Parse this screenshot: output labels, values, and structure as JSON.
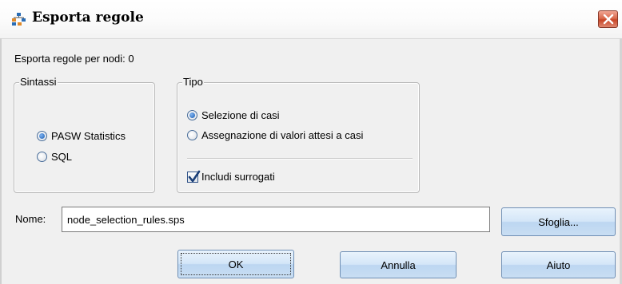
{
  "window": {
    "title": "Esporta regole",
    "icon": "tree-nodes-icon"
  },
  "nodes_label": "Esporta regole per nodi: 0",
  "syntax": {
    "legend": "Sintassi",
    "options": [
      {
        "label": "PASW Statistics",
        "checked": true
      },
      {
        "label": "SQL",
        "checked": false
      }
    ]
  },
  "type": {
    "legend": "Tipo",
    "options": [
      {
        "label": "Selezione di casi",
        "checked": true
      },
      {
        "label": "Assegnazione di valori attesi a casi",
        "checked": false
      }
    ],
    "surrogates": {
      "label": "Includi surrogati",
      "checked": true
    }
  },
  "name": {
    "label": "Nome:",
    "value": "node_selection_rules.sps"
  },
  "buttons": {
    "browse": "Sfoglia...",
    "ok": "OK",
    "cancel": "Annulla",
    "help": "Aiuto"
  },
  "colors": {
    "close_button": "#c84527",
    "button_face": "#d4e6f8",
    "radio_dot": "#1c5fb5"
  }
}
